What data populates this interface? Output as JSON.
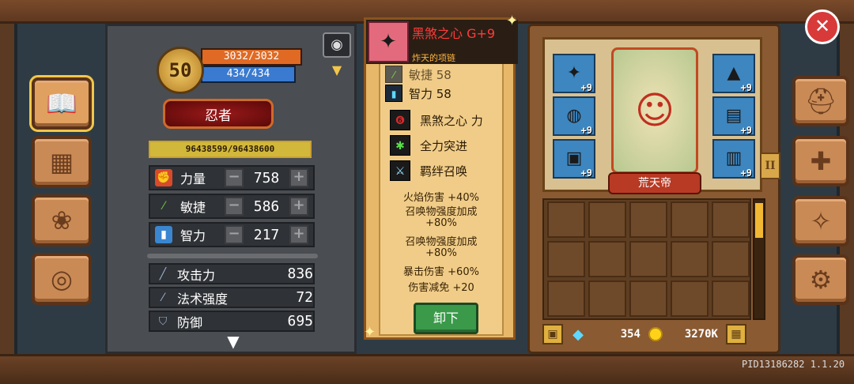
{
  "left_nav": [
    {
      "icon": "book-icon",
      "glyph": "📖"
    },
    {
      "icon": "chest-icon",
      "glyph": "▦"
    },
    {
      "icon": "paw-icon",
      "glyph": "❀"
    },
    {
      "icon": "wheel-icon",
      "glyph": "◎"
    }
  ],
  "character": {
    "level": "50",
    "hp": "3032/3032",
    "mp": "434/434",
    "class_name": "忍者",
    "exp": "96438599/96438600",
    "exp_fraction": 0.99999999,
    "attributes": [
      {
        "label": "力量",
        "value": "758",
        "icon": "fist-icon",
        "color": "#d84a2a"
      },
      {
        "label": "敏捷",
        "value": "586",
        "icon": "feather-icon",
        "color": "#4aa82a"
      },
      {
        "label": "智力",
        "value": "217",
        "icon": "book-blue-icon",
        "color": "#3a86d0"
      }
    ],
    "stats": [
      {
        "label": "攻击力",
        "value": "836",
        "icon": "sword-icon"
      },
      {
        "label": "法术强度",
        "value": "72",
        "icon": "wand-icon"
      },
      {
        "label": "防御",
        "value": "695",
        "icon": "shield-icon"
      }
    ]
  },
  "item": {
    "name": "黑煞之心 G+9",
    "subtitle": "炸天的项链",
    "partial_attr": "敏捷 58",
    "attr": "智力 58",
    "skills": [
      {
        "label": "黑煞之心 力",
        "icon": "dark-heart-icon",
        "glyph": "❻"
      },
      {
        "label": "全力突进",
        "icon": "dash-icon",
        "glyph": "✱"
      },
      {
        "label": "羁绊召唤",
        "icon": "summon-icon",
        "glyph": "⚔"
      }
    ],
    "bonuses": [
      "火焰伤害 +40%",
      "召唤物强度加成",
      "+80%",
      "召唤物强度加成",
      "+80%",
      "暴击伤害 +60%",
      "伤害减免 +20"
    ],
    "unequip_label": "卸下"
  },
  "equipment": {
    "hero_name": "荒天帝",
    "tab_label": "II",
    "slots": [
      {
        "plus": "+9",
        "icon": "necklace-slot-icon",
        "glyph": "✦"
      },
      {
        "plus": "+9",
        "icon": "ring-slot-icon",
        "glyph": "◍"
      },
      {
        "plus": "+9",
        "icon": "armor-slot-icon",
        "glyph": "▣"
      },
      {
        "plus": "+9",
        "icon": "helmet-slot-icon",
        "glyph": "▲"
      },
      {
        "plus": "+9",
        "icon": "glove-slot-icon",
        "glyph": "▤"
      },
      {
        "plus": "+9",
        "icon": "boot-slot-icon",
        "glyph": "▥"
      }
    ]
  },
  "currency": {
    "gems": "354",
    "gold": "3270K"
  },
  "right_nav": [
    {
      "icon": "helmet-icon",
      "glyph": "⛑"
    },
    {
      "icon": "upgrade-icon",
      "glyph": "✚"
    },
    {
      "icon": "compass-icon",
      "glyph": "✧"
    },
    {
      "icon": "gear-icon",
      "glyph": "⚙"
    }
  ],
  "build_id": "PID13186282 1.1.20"
}
